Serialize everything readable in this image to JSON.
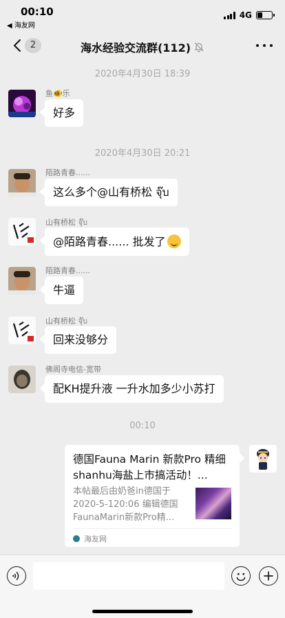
{
  "status_bar": {
    "time": "00:10",
    "back_app": "◀ 海友网",
    "network": "4G",
    "battery_level": 0.35
  },
  "nav": {
    "badge": "2",
    "title": "海水经验交流群(112)"
  },
  "messages": [
    {
      "type": "time",
      "text": "2020年4月30日 18:39"
    },
    {
      "type": "msg",
      "sender": "鱼🐠乐",
      "text": "好多"
    },
    {
      "type": "time",
      "text": "2020年4月30日 20:21"
    },
    {
      "type": "msg",
      "sender": "陌路青春......",
      "text": "这么多个@山有桥松 จุ๊บ"
    },
    {
      "type": "msg",
      "sender": "山有桥松 จุ๊บ",
      "text": "@陌路青春...... 批发了"
    },
    {
      "type": "msg",
      "sender": "陌路青春......",
      "text": "牛逼"
    },
    {
      "type": "msg",
      "sender": "山有桥松 จุ๊บ",
      "text": "回来没够分"
    },
    {
      "type": "msg",
      "sender": "佛阁寺电信-宽带",
      "text": "配KH提升液  一升水加多少小苏打"
    },
    {
      "type": "time",
      "text": "00:10"
    }
  ],
  "link_card": {
    "title": "德国Fauna Marin 新款Pro 精细shanhu海盐上市搞活动！...",
    "description": "本帖最后由奶爸in德国于2020-5-120:06 编辑德国FaunaMarin新款Pro精...",
    "source": "海友网"
  },
  "colors": {
    "background": "#ededed",
    "bubble": "#ffffff",
    "input_bar": "#f6f6f6"
  }
}
